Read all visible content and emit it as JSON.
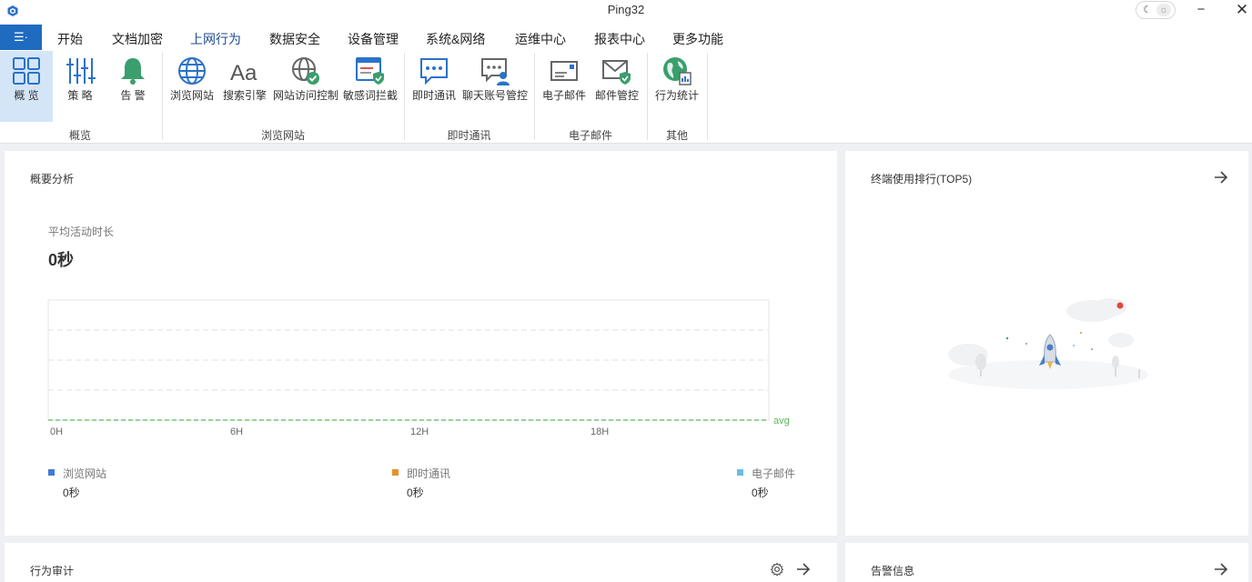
{
  "window": {
    "title": "Ping32",
    "theme_moon": "☾",
    "theme_sun": "☼",
    "minimize": "−",
    "close": "✕"
  },
  "menu": {
    "app_button": "☰·",
    "items": [
      "开始",
      "文档加密",
      "上网行为",
      "数据安全",
      "设备管理",
      "系统&网络",
      "运维中心",
      "报表中心",
      "更多功能"
    ],
    "active": "上网行为"
  },
  "ribbon": {
    "buttons": [
      {
        "label": "概 览",
        "icon": "overview-grid-icon"
      },
      {
        "label": "策 略",
        "icon": "policy-sliders-icon"
      },
      {
        "label": "告 警",
        "icon": "alarm-bell-icon"
      },
      {
        "label": "浏览网站",
        "icon": "globe-icon"
      },
      {
        "label": "搜索引擎",
        "icon": "search-engine-aa-icon"
      },
      {
        "label": "网站访问控制",
        "icon": "globe-check-icon"
      },
      {
        "label": "敏感词拦截",
        "icon": "sensitive-word-shield-icon"
      },
      {
        "label": "即时通讯",
        "icon": "chat-bubble-icon"
      },
      {
        "label": "聊天账号管控",
        "icon": "chat-account-icon"
      },
      {
        "label": "电子邮件",
        "icon": "email-icon"
      },
      {
        "label": "邮件管控",
        "icon": "email-shield-icon"
      },
      {
        "label": "行为统计",
        "icon": "behavior-stats-globe-icon"
      }
    ],
    "groups": [
      "概览",
      "浏览网站",
      "即时通讯",
      "电子邮件",
      "其他"
    ]
  },
  "summary": {
    "title": "概要分析",
    "metric_label": "平均活动时长",
    "metric_value": "0秒",
    "chart_data": {
      "type": "line",
      "x": [
        "0H",
        "6H",
        "12H",
        "18H"
      ],
      "series": [
        {
          "name": "avg",
          "values": [
            0,
            0,
            0,
            0
          ]
        }
      ],
      "avg_label": "avg",
      "grid": true
    },
    "legend": [
      {
        "label": "浏览网站",
        "value": "0秒",
        "color": "#3f7bd6"
      },
      {
        "label": "即时通讯",
        "value": "0秒",
        "color": "#e8912b"
      },
      {
        "label": "电子邮件",
        "value": "0秒",
        "color": "#69bfe0"
      }
    ]
  },
  "top5": {
    "title": "终端使用排行(TOP5)"
  },
  "audit": {
    "title": "行为审计"
  },
  "alerts": {
    "title": "告警信息"
  },
  "colors": {
    "accent": "#1f6bbf",
    "avg_line": "#5cb85c"
  }
}
